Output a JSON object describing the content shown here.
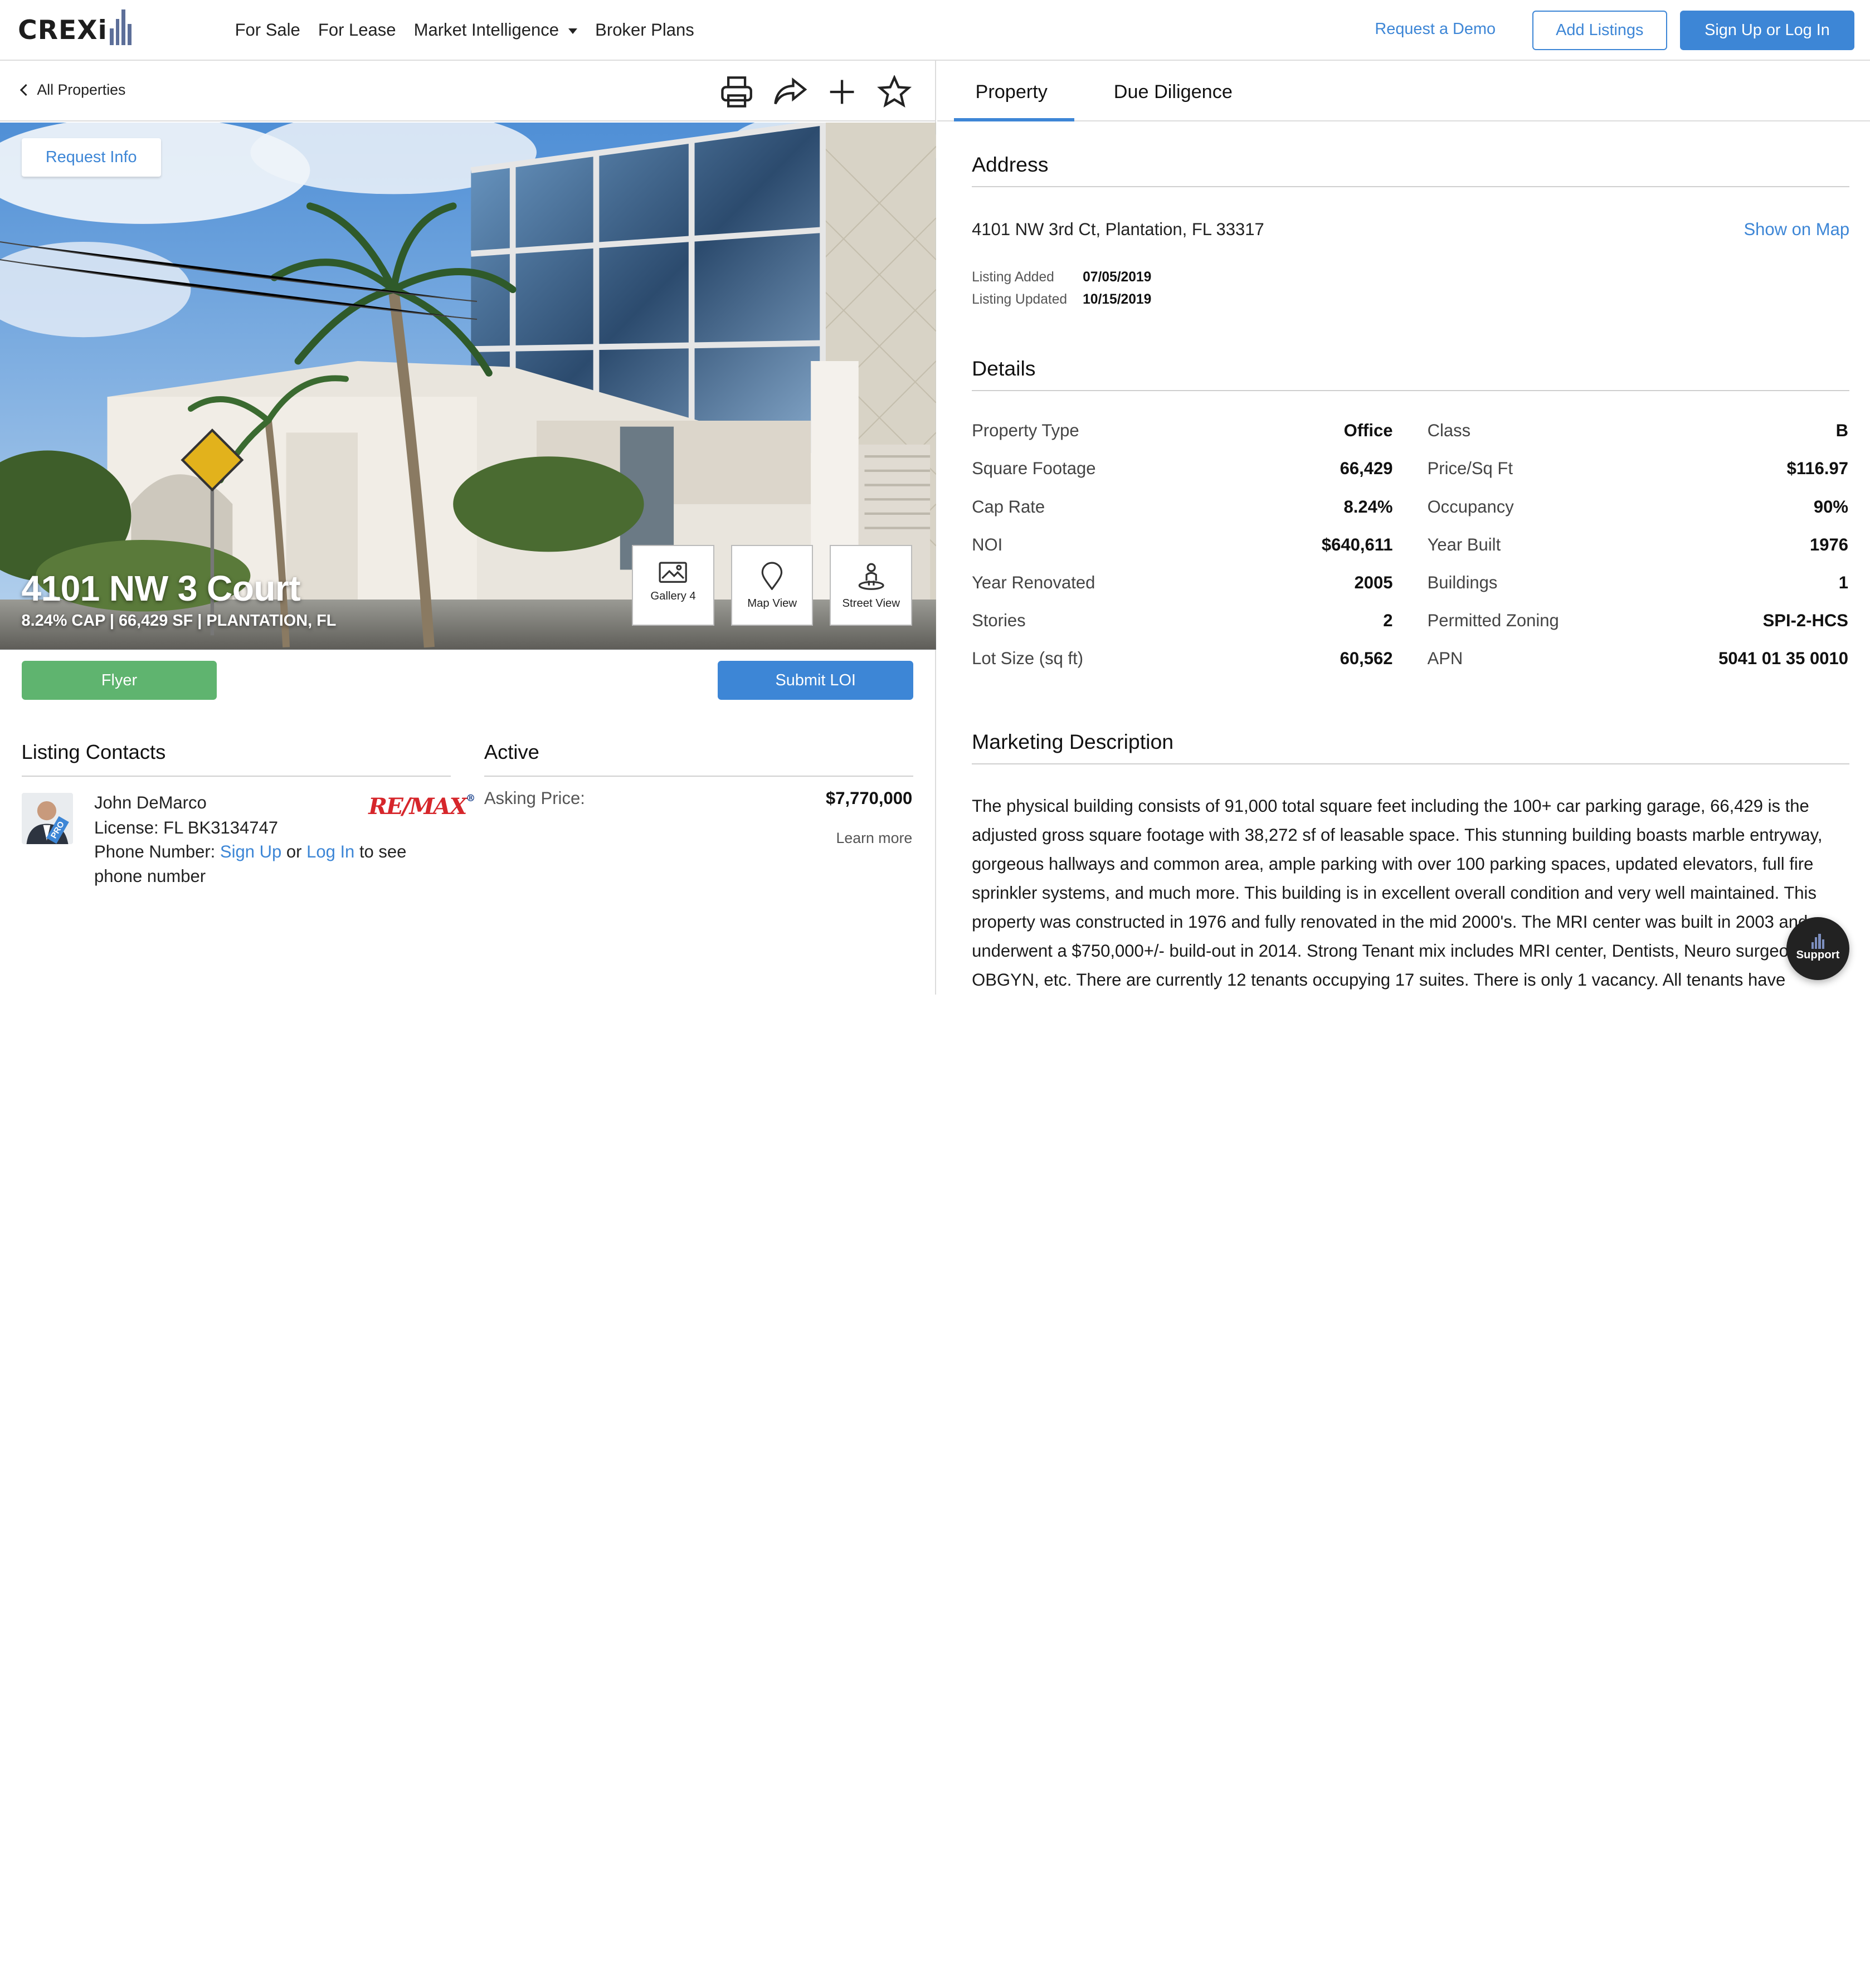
{
  "brand": {
    "name": "CREXi",
    "accent": "#3d86d6",
    "green": "#5fb46f"
  },
  "nav": {
    "links": [
      "For Sale",
      "For Lease",
      "Market Intelligence",
      "Broker Plans"
    ],
    "request_demo": "Request a Demo",
    "add_listings": "Add Listings",
    "sign_up": "Sign Up or Log In"
  },
  "subbar": {
    "back_label": "All Properties",
    "tools": [
      "print-icon",
      "share-icon",
      "plus-icon",
      "star-icon"
    ]
  },
  "hero": {
    "request_info": "Request Info",
    "title": "4101 NW 3 Court",
    "subtitle": "8.24% CAP | 66,429 SF | PLANTATION, FL",
    "views": [
      {
        "label": "Gallery 4",
        "icon": "gallery-icon"
      },
      {
        "label": "Map View",
        "icon": "map-pin-icon"
      },
      {
        "label": "Street View",
        "icon": "street-view-icon"
      }
    ]
  },
  "actions": {
    "flyer": "Flyer",
    "submit_loi": "Submit LOI"
  },
  "contacts": {
    "heading": "Listing Contacts",
    "name": "John DeMarco",
    "license": "License: FL BK3134747",
    "phone_prefix": "Phone Number:",
    "sign_up": "Sign Up",
    "or": "or",
    "log_in": "Log In",
    "phone_suffix": "to see",
    "phone_suffix2": "phone number",
    "badge": "PRO",
    "brokerage_logo": "RE/MAX"
  },
  "status": {
    "heading": "Active",
    "asking_label": "Asking Price:",
    "asking_value": "$7,770,000",
    "learn_more": "Learn more"
  },
  "tabs": {
    "property": "Property",
    "due_diligence": "Due Diligence"
  },
  "address": {
    "heading": "Address",
    "line": "4101 NW 3rd Ct, Plantation, FL 33317",
    "show_map": "Show on Map",
    "added_label": "Listing Added",
    "added_value": "07/05/2019",
    "updated_label": "Listing Updated",
    "updated_value": "10/15/2019"
  },
  "details": {
    "heading": "Details",
    "left": [
      {
        "label": "Property Type",
        "value": "Office"
      },
      {
        "label": "Square Footage",
        "value": "66,429"
      },
      {
        "label": "Cap Rate",
        "value": "8.24%"
      },
      {
        "label": "NOI",
        "value": "$640,611"
      },
      {
        "label": "Year Renovated",
        "value": "2005"
      },
      {
        "label": "Stories",
        "value": "2"
      },
      {
        "label": "Lot Size (sq ft)",
        "value": "60,562"
      }
    ],
    "right": [
      {
        "label": "Class",
        "value": "B"
      },
      {
        "label": "Price/Sq Ft",
        "value": "$116.97"
      },
      {
        "label": "Occupancy",
        "value": "90%"
      },
      {
        "label": "Year Built",
        "value": "1976"
      },
      {
        "label": "Buildings",
        "value": "1"
      },
      {
        "label": "Permitted Zoning",
        "value": "SPI-2-HCS"
      },
      {
        "label": "APN",
        "value": "5041 01 35 0010"
      }
    ]
  },
  "marketing": {
    "heading": "Marketing Description",
    "text": "The physical building consists of 91,000 total square feet including the 100+ car parking garage, 66,429 is the adjusted gross square footage with 38,272 sf of leasable space. This stunning building boasts marble entryway, gorgeous hallways and common area, ample parking with over 100 parking spaces, updated elevators, full fire sprinkler systems, and much more. This building is in excellent overall condition and very well maintained. This property was constructed in 1976 and fully renovated in the mid 2000's. The MRI center was built in 2003 and underwent a $750,000+/- build-out in 2014. Strong Tenant mix includes MRI center, Dentists, Neuro surgeon, OBGYN, etc. There are currently 12 tenants occupying 17 suites. There is only 1 vacancy. All tenants have"
  },
  "support": {
    "label": "Support"
  }
}
